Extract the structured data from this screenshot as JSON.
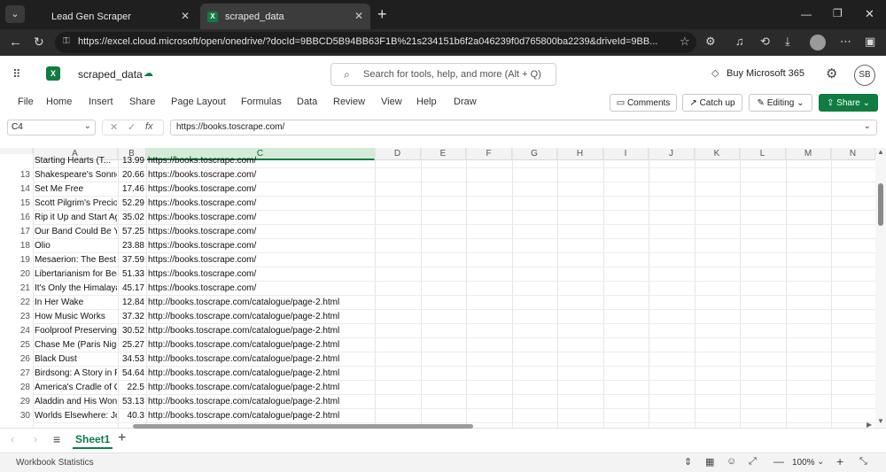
{
  "browser": {
    "tabs": [
      {
        "label": "Lead Gen Scraper",
        "active": false
      },
      {
        "label": "scraped_data",
        "active": true
      }
    ],
    "url": "https://excel.cloud.microsoft/open/onedrive/?docId=9BBCD5B94BB63F1B%21s234151b6f2a046239f0d765800ba2239&driveId=9BB..."
  },
  "excel": {
    "file_name": "scraped_data",
    "search_placeholder": "Search for tools, help, and more (Alt + Q)",
    "buy": "Buy Microsoft 365",
    "avatar": "SB",
    "ribbon_tabs": [
      "File",
      "Home",
      "Insert",
      "Share",
      "Page Layout",
      "Formulas",
      "Data",
      "Review",
      "View",
      "Help",
      "Draw"
    ],
    "comments": "Comments",
    "catch_up": "Catch up",
    "editing": "Editing",
    "share": "Share",
    "name_box": "C4",
    "fx": "fx",
    "formula": "https://books.toscrape.com/",
    "columns": [
      "A",
      "B",
      "C",
      "D",
      "E",
      "F",
      "G",
      "H",
      "I",
      "J",
      "K",
      "L",
      "M",
      "N"
    ],
    "partial_row": {
      "n": "",
      "a": "Starting Hearts (T...",
      "b": "13.99",
      "c": "https://books.toscrape.com/"
    },
    "rows": [
      {
        "n": "13",
        "a": "Shakespeare's Sonnets",
        "b": "20.66",
        "c": "https://books.toscrape.com/"
      },
      {
        "n": "14",
        "a": "Set Me Free",
        "b": "17.46",
        "c": "https://books.toscrape.com/"
      },
      {
        "n": "15",
        "a": "Scott Pilgrim's Precious Little Life",
        "b": "52.29",
        "c": "https://books.toscrape.com/"
      },
      {
        "n": "16",
        "a": "Rip it Up and Start Again",
        "b": "35.02",
        "c": "https://books.toscrape.com/"
      },
      {
        "n": "17",
        "a": "Our Band Could Be Your Life",
        "b": "57.25",
        "c": "https://books.toscrape.com/"
      },
      {
        "n": "18",
        "a": "Olio",
        "b": "23.88",
        "c": "https://books.toscrape.com/"
      },
      {
        "n": "19",
        "a": "Mesaerion: The Best Science Fiction",
        "b": "37.59",
        "c": "https://books.toscrape.com/"
      },
      {
        "n": "20",
        "a": "Libertarianism for Beginners",
        "b": "51.33",
        "c": "https://books.toscrape.com/"
      },
      {
        "n": "21",
        "a": "It's Only the Himalayas",
        "b": "45.17",
        "c": "https://books.toscrape.com/"
      },
      {
        "n": "22",
        "a": "In Her Wake",
        "b": "12.84",
        "c": "http://books.toscrape.com/catalogue/page-2.html"
      },
      {
        "n": "23",
        "a": "How Music Works",
        "b": "37.32",
        "c": "http://books.toscrape.com/catalogue/page-2.html"
      },
      {
        "n": "24",
        "a": "Foolproof Preserving",
        "b": "30.52",
        "c": "http://books.toscrape.com/catalogue/page-2.html"
      },
      {
        "n": "25",
        "a": "Chase Me (Paris Nights)",
        "b": "25.27",
        "c": "http://books.toscrape.com/catalogue/page-2.html"
      },
      {
        "n": "26",
        "a": "Black Dust",
        "b": "34.53",
        "c": "http://books.toscrape.com/catalogue/page-2.html"
      },
      {
        "n": "27",
        "a": "Birdsong: A Story in Pictures",
        "b": "54.64",
        "c": "http://books.toscrape.com/catalogue/page-2.html"
      },
      {
        "n": "28",
        "a": "America's Cradle of Quarterbacks",
        "b": "22.5",
        "c": "http://books.toscrape.com/catalogue/page-2.html"
      },
      {
        "n": "29",
        "a": "Aladdin and His Wonderful Lamp",
        "b": "53.13",
        "c": "http://books.toscrape.com/catalogue/page-2.html"
      },
      {
        "n": "30",
        "a": "Worlds Elsewhere: Journeys",
        "b": "40.3",
        "c": "http://books.toscrape.com/catalogue/page-2.html"
      }
    ],
    "sheet_tab": "Sheet1",
    "status_left": "Workbook Statistics",
    "zoom": "100%",
    "accent": "#107c41"
  }
}
